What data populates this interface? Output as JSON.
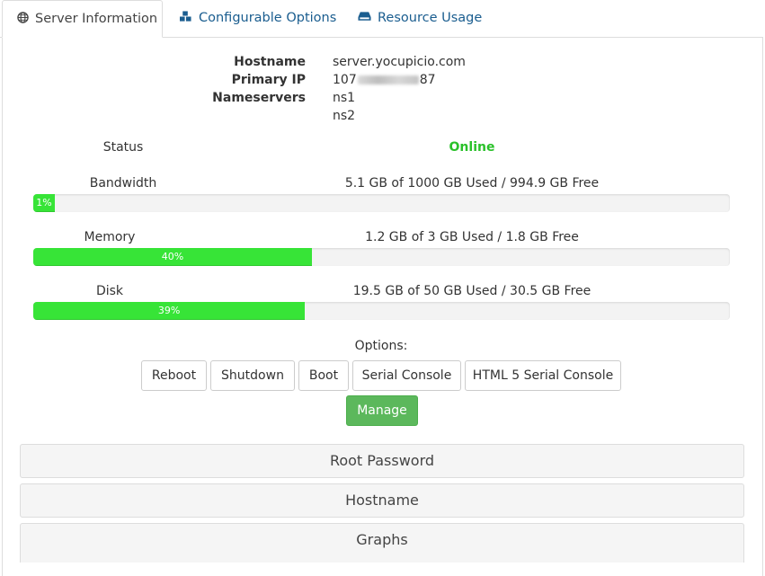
{
  "tabs": [
    {
      "label": "Server Information",
      "active": true,
      "icon": "globe-icon"
    },
    {
      "label": "Configurable Options",
      "active": false,
      "icon": "cubes-icon"
    },
    {
      "label": "Resource Usage",
      "active": false,
      "icon": "hdd-icon"
    }
  ],
  "info": {
    "hostname_label": "Hostname",
    "hostname_value": "server.yocupicio.com",
    "primary_ip_label": "Primary IP",
    "primary_ip_start": "107",
    "primary_ip_end": "87",
    "nameservers_label": "Nameservers",
    "nameservers": [
      "ns1",
      "ns2"
    ]
  },
  "status": {
    "label": "Status",
    "value": "Online",
    "color": "#2ac12a"
  },
  "resources": {
    "bandwidth": {
      "label": "Bandwidth",
      "text": "5.1 GB of 1000 GB Used / 994.9 GB Free",
      "percent": 1,
      "percent_label": "1%"
    },
    "memory": {
      "label": "Memory",
      "text": "1.2 GB of 3 GB Used / 1.8 GB Free",
      "percent": 40,
      "percent_label": "40%"
    },
    "disk": {
      "label": "Disk",
      "text": "19.5 GB of 50 GB Used / 30.5 GB Free",
      "percent": 39,
      "percent_label": "39%"
    }
  },
  "options": {
    "label": "Options:",
    "buttons": [
      "Reboot",
      "Shutdown",
      "Boot",
      "Serial Console",
      "HTML 5 Serial Console"
    ],
    "manage": "Manage"
  },
  "accordion": [
    "Root Password",
    "Hostname",
    "Graphs"
  ],
  "colors": {
    "link": "#1a5d8f",
    "progress": "#37e437",
    "success_button": "#5cb85c"
  }
}
